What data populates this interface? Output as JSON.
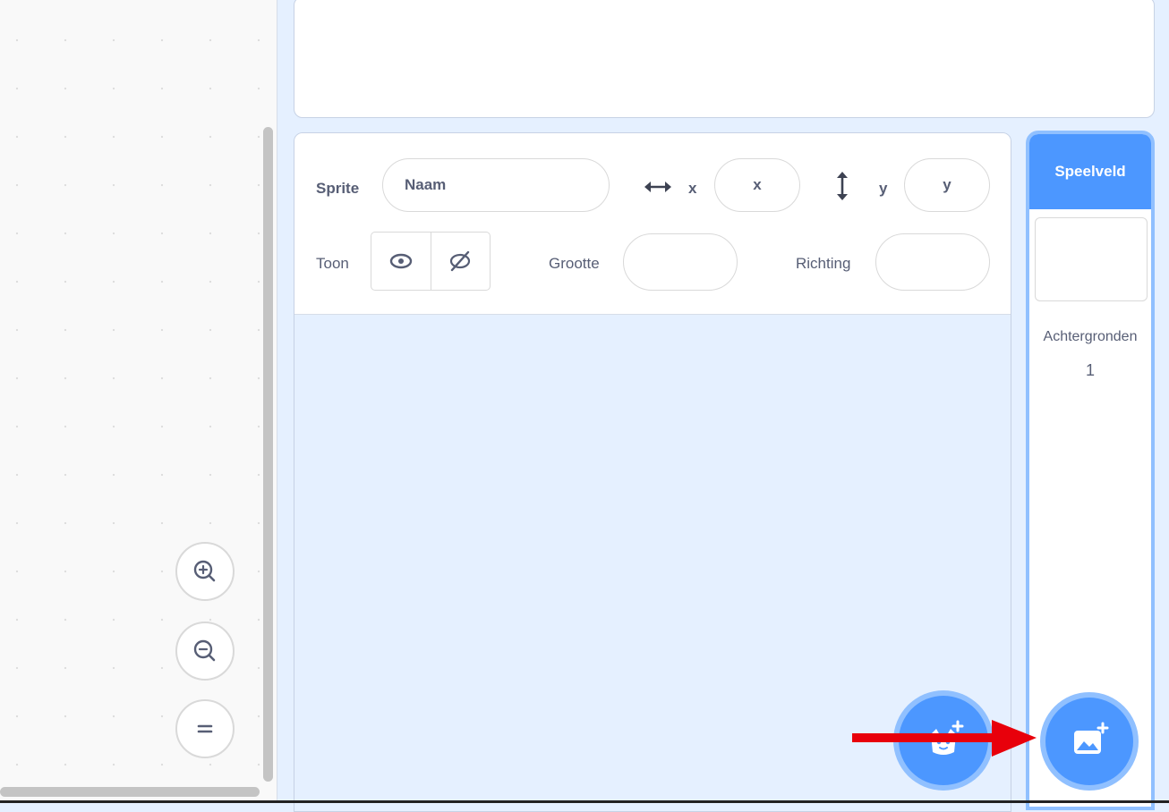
{
  "sprite_info": {
    "sprite_label": "Sprite",
    "name_value": "Naam",
    "x_label": "x",
    "x_value": "x",
    "y_label": "y",
    "y_value": "y",
    "show_label": "Toon",
    "size_label": "Grootte",
    "size_value": "",
    "direction_label": "Richting",
    "direction_value": ""
  },
  "target_pane": {
    "stage_label": "Speelveld",
    "backdrops_label": "Achtergronden",
    "backdrops_count": "1"
  },
  "colors": {
    "accent": "#4c97ff",
    "accent_light": "#90c0ff",
    "pane_background": "#e5f0ff",
    "text": "#575e75",
    "annotation_arrow": "#e8000b"
  },
  "icons": {
    "zoom_in": "zoom-in-icon",
    "zoom_out": "zoom-out-icon",
    "zoom_reset": "zoom-reset-icon",
    "show": "eye-icon",
    "hide": "eye-off-icon",
    "add_sprite": "add-sprite-icon",
    "add_backdrop": "add-backdrop-icon"
  }
}
